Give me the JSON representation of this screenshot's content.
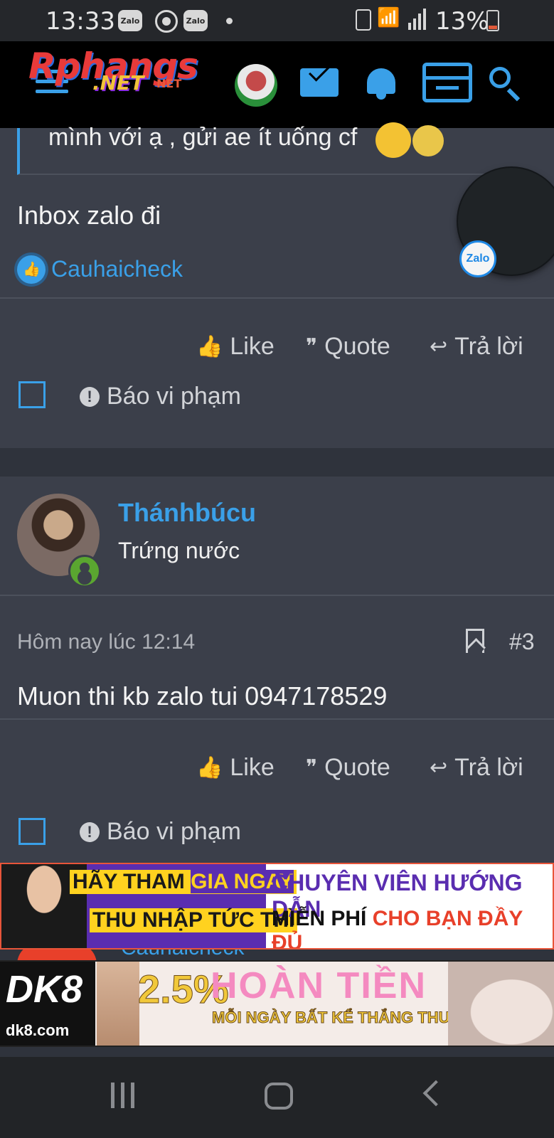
{
  "status_bar": {
    "time": "13:33",
    "zalo_labels": [
      "Zalo",
      "Zalo"
    ],
    "battery": "13%"
  },
  "header": {
    "logo_text": "Rphangs",
    "logo_sub": "Rphangs",
    "logo_domain": ".NET",
    "logo_domain_small": "NET",
    "icons": [
      "menu-icon",
      "avatar",
      "mail-icon",
      "bell-icon",
      "store-icon",
      "search-icon"
    ],
    "accent_color": "#3aa0e8"
  },
  "post1": {
    "quote_text": "mình với ạ , gửi ae ít uống cf",
    "message": "Inbox zalo đi",
    "liked_by": "Cauhaicheck",
    "actions": {
      "like": "Like",
      "quote": "Quote",
      "reply": "Trả lời"
    },
    "report": "Báo vi phạm"
  },
  "zalo_float": {
    "label": "Zalo"
  },
  "post2": {
    "username": "Thánhbúcu",
    "user_title": "Trứng nước",
    "timestamp": "Hôm nay lúc 12:14",
    "post_number": "#3",
    "message": "Muon thi kb zalo tui 0947178529",
    "actions": {
      "like": "Like",
      "quote": "Quote",
      "reply": "Trả lời"
    },
    "report": "Báo vi phạm",
    "next_poster_partial": "Cauhaicheck"
  },
  "ads": {
    "ad1": {
      "left_line1_a": "HÃY THAM",
      "left_line1_b": "GIA NGAY",
      "left_line2": "THU NHẬP TỨC THÌ",
      "right_line1": "CHUYÊN VIÊN HƯỚNG DẪN",
      "right_line2_a": "MIỄN PHÍ",
      "right_line2_b": "CHO BẠN ĐẦY ĐỦ"
    },
    "ad2": {
      "brand": "DK8",
      "site": "dk8.com",
      "percent": "2.5%",
      "headline": "HOÀN TIỀN",
      "subline": "MỖI NGÀY BẤT KỂ THẮNG THUA"
    }
  }
}
